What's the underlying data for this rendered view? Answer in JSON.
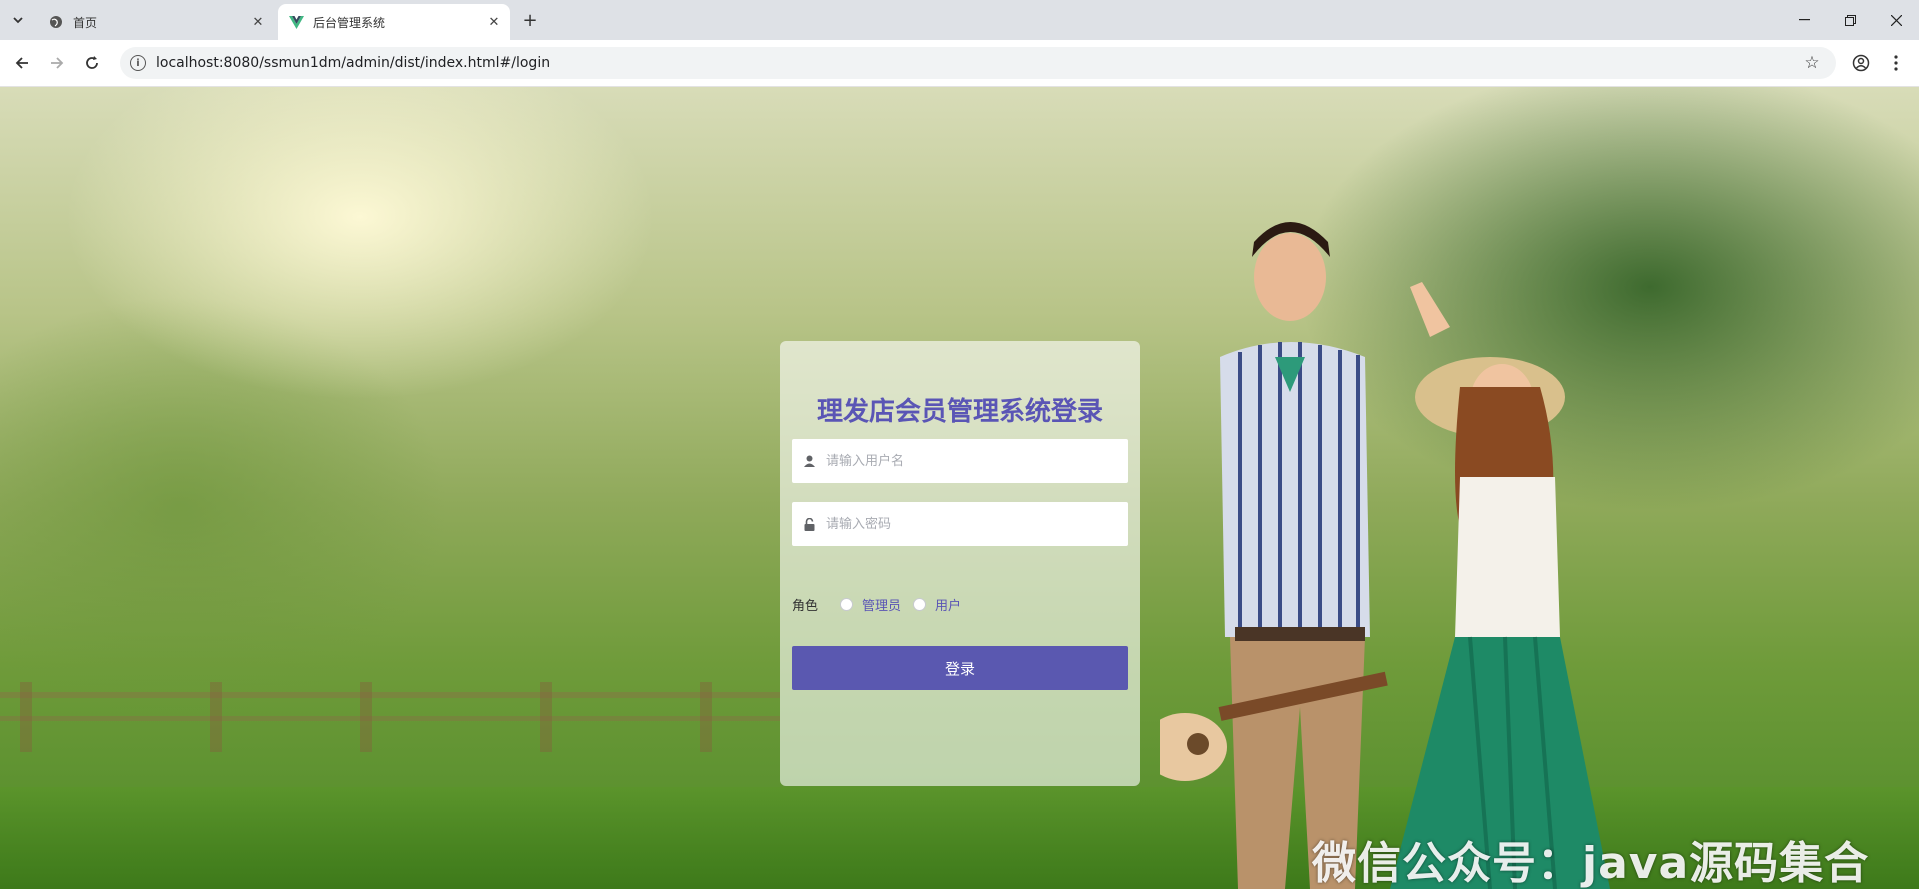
{
  "browser": {
    "tabs": [
      {
        "title": "首页",
        "active": false,
        "favicon": "globe-icon"
      },
      {
        "title": "后台管理系统",
        "active": true,
        "favicon": "vue-logo-icon"
      }
    ],
    "url": "localhost:8080/ssmun1dm/admin/dist/index.html#/login"
  },
  "login": {
    "title": "理发店会员管理系统登录",
    "username_placeholder": "请输入用户名",
    "password_placeholder": "请输入密码",
    "role_label": "角色",
    "roles": [
      "管理员",
      "用户"
    ],
    "submit_label": "登录"
  },
  "watermark": "微信公众号：java源码集合",
  "colors": {
    "accent": "#5a55b5",
    "button": "#5a58b0"
  }
}
